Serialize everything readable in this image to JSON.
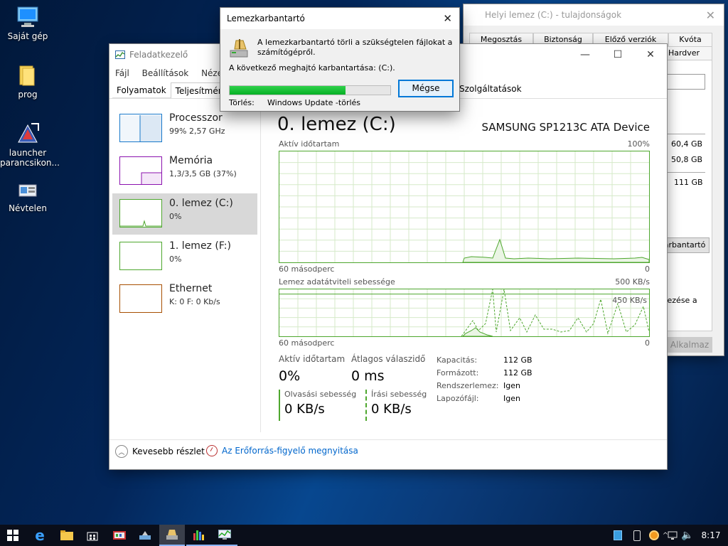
{
  "desktop": {
    "icons": [
      {
        "label": "Saját gép"
      },
      {
        "label": "prog"
      },
      {
        "label_l1": "launcher",
        "label_l2": "parancsikon..."
      },
      {
        "label": "Névtelen"
      }
    ]
  },
  "properties_window": {
    "title": "Helyi lemez (C:) - tulajdonságok",
    "tabs": [
      "Megosztás",
      "Biztonság",
      "Előző verziók",
      "Kvóta",
      "Hardver"
    ],
    "values": [
      "60,4 GB",
      "50,8 GB",
      "111 GB"
    ],
    "cleanup_button": "Lemezkarbantartó",
    "partial_text": "vezése a",
    "apply_button": "Alkalmaz"
  },
  "task_manager": {
    "title": "Feladatkezelő",
    "menu": [
      "Fájl",
      "Beállítások",
      "Nézet"
    ],
    "tabs": [
      "Folyamatok",
      "Teljesítmény",
      "Szolgáltatások"
    ],
    "active_tab": "Teljesítmény",
    "sidebar": [
      {
        "name": "Processzor",
        "detail": "99% 2,57 GHz",
        "color": "#1979ca"
      },
      {
        "name": "Memória",
        "detail": "1,3/3,5 GB (37%)",
        "color": "#8b12ae"
      },
      {
        "name": "0. lemez (C:)",
        "detail": "0%",
        "color": "#4ea72e",
        "selected": true
      },
      {
        "name": "1. lemez (F:)",
        "detail": "0%",
        "color": "#4ea72e"
      },
      {
        "name": "Ethernet",
        "detail": "K: 0 F: 0 Kb/s",
        "color": "#a74f01"
      }
    ],
    "main": {
      "heading": "0. lemez (C:)",
      "device": "SAMSUNG SP1213C ATA Device",
      "graph1_label": "Aktív időtartam",
      "graph1_max": "100%",
      "graph1_xleft": "60 másodperc",
      "graph1_xright": "0",
      "graph2_label": "Lemez adatátviteli sebessége",
      "graph2_max": "500 KB/s",
      "graph2_mark": "450 KB/s",
      "graph2_xleft": "60 másodperc",
      "graph2_xright": "0",
      "stats": {
        "active_label": "Aktív időtartam",
        "active_value": "0%",
        "resp_label": "Átlagos válaszidő",
        "resp_value": "0 ms",
        "read_label": "Olvasási sebesség",
        "read_value": "0 KB/s",
        "write_label": "Írási sebesség",
        "write_value": "0 KB/s"
      },
      "info": [
        {
          "k": "Kapacitás:",
          "v": "112 GB"
        },
        {
          "k": "Formázott:",
          "v": "112 GB"
        },
        {
          "k": "Rendszerlemez:",
          "v": "Igen"
        },
        {
          "k": "Lapozófájl:",
          "v": "Igen"
        }
      ]
    },
    "footer": {
      "less_details": "Kevesebb részlet",
      "open_monitor": "Az Erőforrás-figyelő megnyitása"
    }
  },
  "disk_cleanup": {
    "title": "Lemezkarbantartó",
    "message_l1": "A lemezkarbantartó törli a szükségtelen fájlokat a",
    "message_l2": "számítógépről.",
    "maint_line": "A következő meghajtó karbantartása:  (C:).",
    "progress": 0.72,
    "cancel_button": "Mégse",
    "delete_label": "Törlés:",
    "delete_value": "Windows Update -törlés"
  },
  "taskbar": {
    "clock": "8:17"
  },
  "colors": {
    "accent": "#0078d7",
    "disk_green": "#4ea72e",
    "progress_green": "#06b025"
  }
}
